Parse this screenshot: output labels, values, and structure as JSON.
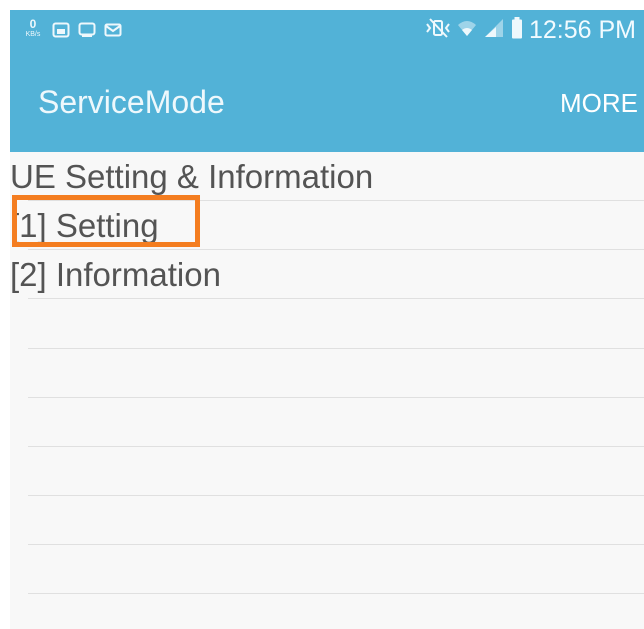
{
  "status_bar": {
    "data_speed_value": "0",
    "data_speed_unit": "KB/s",
    "notification_icons": [
      "gallery-icon",
      "cast-icon",
      "mail-icon"
    ],
    "system_icons": [
      "mute-vibrate-icon",
      "wifi-icon",
      "signal-icon",
      "battery-icon"
    ],
    "time": "12:56 PM"
  },
  "app_bar": {
    "title": "ServiceMode",
    "more_label": "MORE"
  },
  "menu": {
    "header": "UE Setting & Information",
    "items": [
      {
        "label": "[1] Setting",
        "highlighted": true
      },
      {
        "label": "[2] Information"
      }
    ]
  },
  "colors": {
    "app_bar": "#52b2d7",
    "background": "#f8f8f8",
    "text": "#545454",
    "divider": "#e0e0e0",
    "highlight": "#f47d20"
  }
}
